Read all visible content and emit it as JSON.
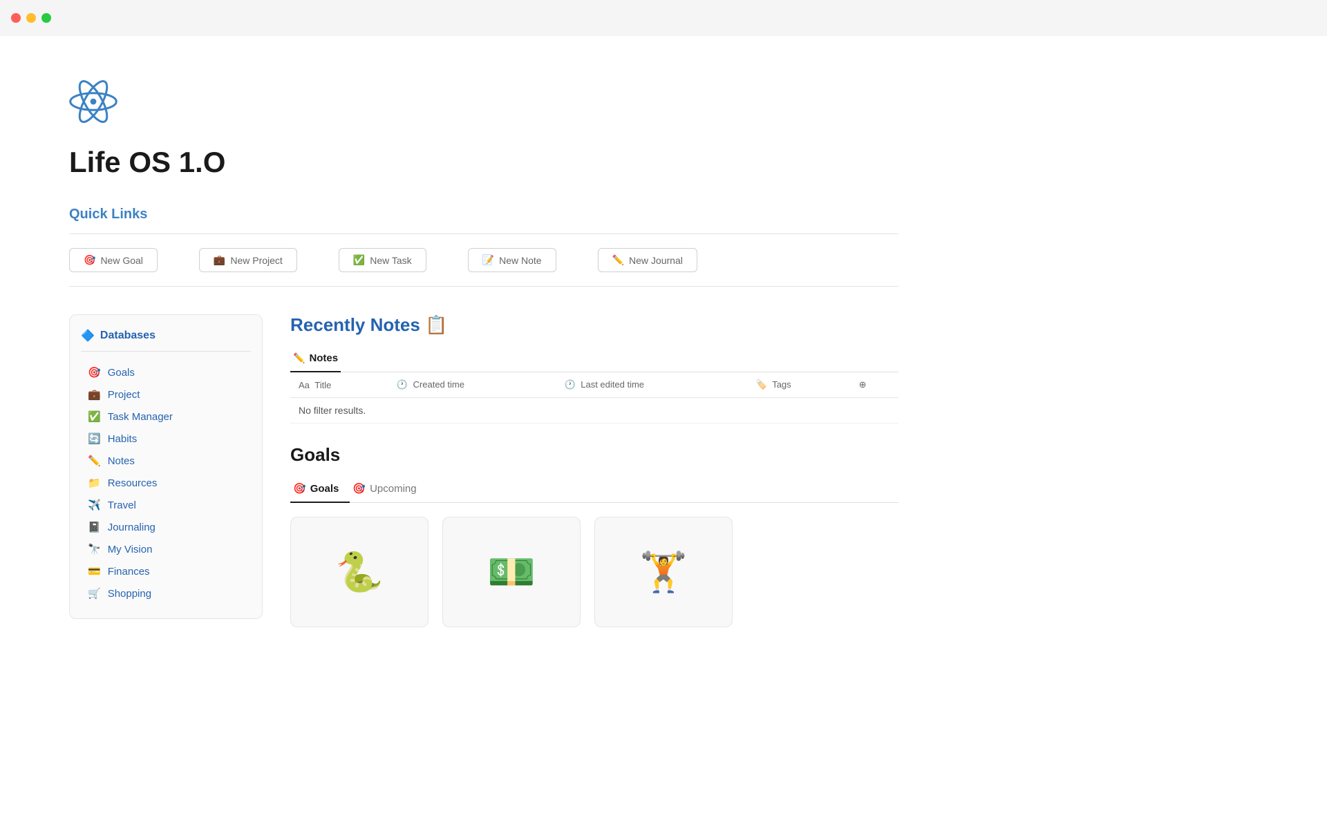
{
  "titlebar": {
    "traffic_lights": [
      "red",
      "yellow",
      "green"
    ]
  },
  "app": {
    "title": "Life OS 1.O"
  },
  "quick_links": {
    "section_title": "Quick Links",
    "buttons": [
      {
        "id": "new-goal",
        "label": "New Goal",
        "icon": "🎯"
      },
      {
        "id": "new-project",
        "label": "New Project",
        "icon": "💼"
      },
      {
        "id": "new-task",
        "label": "New Task",
        "icon": "✅"
      },
      {
        "id": "new-note",
        "label": "New Note",
        "icon": "📝"
      },
      {
        "id": "new-journal",
        "label": "New Journal",
        "icon": "✏️"
      }
    ]
  },
  "sidebar": {
    "header": "Databases",
    "items": [
      {
        "id": "goals",
        "label": "Goals",
        "icon": "🎯"
      },
      {
        "id": "project",
        "label": "Project",
        "icon": "💼"
      },
      {
        "id": "task-manager",
        "label": "Task Manager",
        "icon": "✅"
      },
      {
        "id": "habits",
        "label": "Habits",
        "icon": "🔄"
      },
      {
        "id": "notes",
        "label": "Notes",
        "icon": "✏️"
      },
      {
        "id": "resources",
        "label": "Resources",
        "icon": "📁"
      },
      {
        "id": "travel",
        "label": "Travel",
        "icon": "✈️"
      },
      {
        "id": "journaling",
        "label": "Journaling",
        "icon": "📓"
      },
      {
        "id": "my-vision",
        "label": "My Vision",
        "icon": "🔭"
      },
      {
        "id": "finances",
        "label": "Finances",
        "icon": "💳"
      },
      {
        "id": "shopping",
        "label": "Shopping",
        "icon": "🛒"
      }
    ]
  },
  "recently_notes": {
    "heading": "Recently Notes",
    "heading_emoji": "📋",
    "tab_label": "Notes",
    "tab_icon": "✏️",
    "columns": [
      {
        "id": "title",
        "label": "Title",
        "prefix_icon": "Aa"
      },
      {
        "id": "created_time",
        "label": "Created time",
        "icon": "🕐"
      },
      {
        "id": "last_edited_time",
        "label": "Last edited time",
        "icon": "🕐"
      },
      {
        "id": "tags",
        "label": "Tags",
        "icon": "🏷️"
      }
    ],
    "empty_message": "No filter results."
  },
  "goals_section": {
    "heading": "Goals",
    "tabs": [
      {
        "id": "goals",
        "label": "Goals",
        "icon": "🎯",
        "active": true
      },
      {
        "id": "upcoming",
        "label": "Upcoming",
        "icon": "🎯",
        "active": false
      }
    ],
    "cards": [
      {
        "id": "python",
        "emoji": "🐍"
      },
      {
        "id": "money",
        "emoji": "💵"
      },
      {
        "id": "fitness",
        "emoji": "🏋️"
      }
    ]
  }
}
